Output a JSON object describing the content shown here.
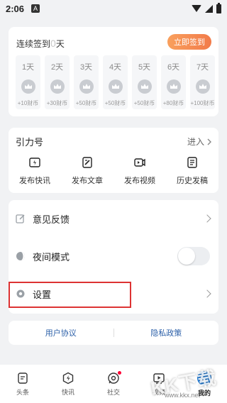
{
  "status": {
    "time": "2:06",
    "notif_letter": "A"
  },
  "sign": {
    "prefix": "连续签到",
    "count": "0",
    "suffix": "天",
    "button": "立即签到",
    "days": [
      {
        "label": "1天",
        "reward": "+10财币"
      },
      {
        "label": "2天",
        "reward": "+30财币"
      },
      {
        "label": "3天",
        "reward": "+50财币"
      },
      {
        "label": "4天",
        "reward": "+50财币"
      },
      {
        "label": "5天",
        "reward": "+50财币"
      },
      {
        "label": "6天",
        "reward": "+80财币"
      },
      {
        "label": "7天",
        "reward": "+100财币"
      }
    ]
  },
  "yinli": {
    "title": "引力号",
    "enter": "进入",
    "items": [
      {
        "label": "发布快讯",
        "icon": "flash-news-icon"
      },
      {
        "label": "发布文章",
        "icon": "edit-article-icon"
      },
      {
        "label": "发布视频",
        "icon": "video-icon"
      },
      {
        "label": "历史发稿",
        "icon": "document-icon"
      }
    ]
  },
  "settings": {
    "feedback": "意见反馈",
    "night_mode": "夜间模式",
    "night_mode_on": false,
    "settings": "设置"
  },
  "agreement": {
    "user": "用户协议",
    "privacy": "隐私政策"
  },
  "tabs": [
    {
      "label": "头条",
      "icon": "headline-icon"
    },
    {
      "label": "快讯",
      "icon": "flash-icon"
    },
    {
      "label": "社交",
      "icon": "social-icon",
      "badge": true
    },
    {
      "label": "视频",
      "icon": "video-tab-icon"
    },
    {
      "label": "我的",
      "icon": "me-icon",
      "active": true
    }
  ],
  "watermark": {
    "main": "KK下载",
    "sub": "www.kkx.net"
  },
  "colors": {
    "accent": "#f27b4a",
    "link": "#2b5fa8",
    "highlight": "#dd3333",
    "me_blue": "#1e7fe0"
  }
}
